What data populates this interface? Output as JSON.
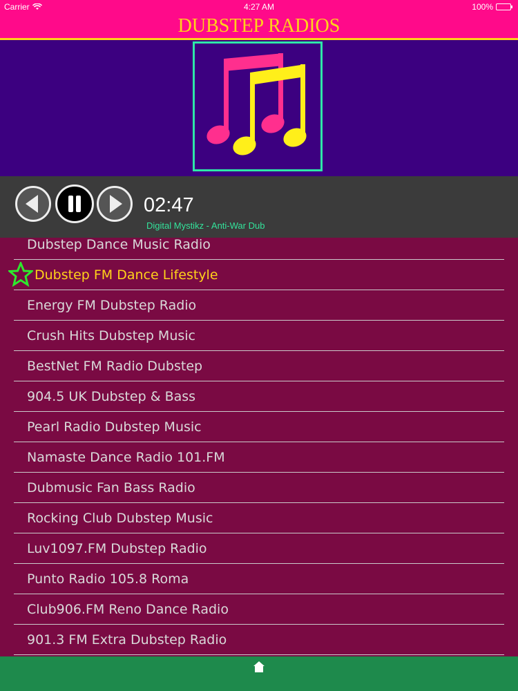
{
  "status_bar": {
    "carrier": "Carrier",
    "time": "4:27 AM",
    "battery": "100%"
  },
  "header": {
    "title": "DUBSTEP RADIOS"
  },
  "player": {
    "elapsed": "02:47",
    "now_playing": "Digital Mystikz - Anti-War Dub"
  },
  "stations": [
    "Dubstep Dance Music Radio",
    "Dubstep FM Dance Lifestyle",
    "Energy FM Dubstep Radio",
    "Crush Hits Dubstep Music",
    "BestNet FM Radio Dubstep",
    "904.5 UK Dubstep & Bass",
    "Pearl Radio Dubstep Music",
    "Namaste Dance Radio 101.FM",
    "Dubmusic Fan Bass Radio",
    "Rocking Club Dubstep Music",
    "Luv1097.FM Dubstep Radio",
    "Punto Radio 105.8 Roma",
    "Club906.FM Reno Dance Radio",
    "901.3 FM Extra Dubstep Radio"
  ],
  "active_station_index": 1,
  "colors": {
    "header_bg": "#ff0a8a",
    "title": "#ffd21a",
    "artwork_bg": "#3c0080",
    "list_bg": "#7a0a43",
    "now_playing": "#33e39b",
    "bottom_bar": "#1e8a4c"
  }
}
